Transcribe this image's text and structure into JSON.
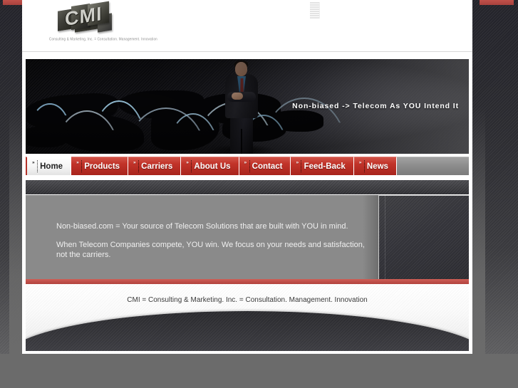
{
  "site": {
    "logo_letters": "CMI",
    "logo_tagline": "Consulting & Marketing, Inc. = Consultation. Management. Innovation"
  },
  "banner": {
    "tagline": "Non-biased -> Telecom As YOU Intend It",
    "image_alt": "businessman-world-map-network"
  },
  "nav": {
    "items": [
      {
        "label": "Home",
        "active": true,
        "icon": "double-arrow-icon"
      },
      {
        "label": "Products",
        "active": false,
        "icon": "double-arrow-icon"
      },
      {
        "label": "Carriers",
        "active": false,
        "icon": "double-arrow-icon"
      },
      {
        "label": "About Us",
        "active": false,
        "icon": "double-arrow-icon"
      },
      {
        "label": "Contact",
        "active": false,
        "icon": "double-arrow-icon"
      },
      {
        "label": "Feed-Back",
        "active": false,
        "icon": "double-arrow-icon"
      },
      {
        "label": "News",
        "active": false,
        "icon": "double-arrow-icon"
      }
    ],
    "arrow_glyph": "»"
  },
  "content": {
    "paragraph1": "Non-biased.com = Your source of Telecom Solutions that are built with YOU in mind.",
    "paragraph2": "When Telecom Companies compete, YOU win. We focus on your needs and satisfaction, not the carriers."
  },
  "footer": {
    "note": "CMI = Consulting & Marketing. Inc. = Consultation. Management. Innovation"
  },
  "colors": {
    "accent_red": "#c2342a",
    "rule_red": "#c0504a",
    "content_gray": "#8a8a8a",
    "page_white": "#ffffff",
    "frame_dark": "#2b2b30",
    "desktop_gray": "#6b6b6b"
  }
}
